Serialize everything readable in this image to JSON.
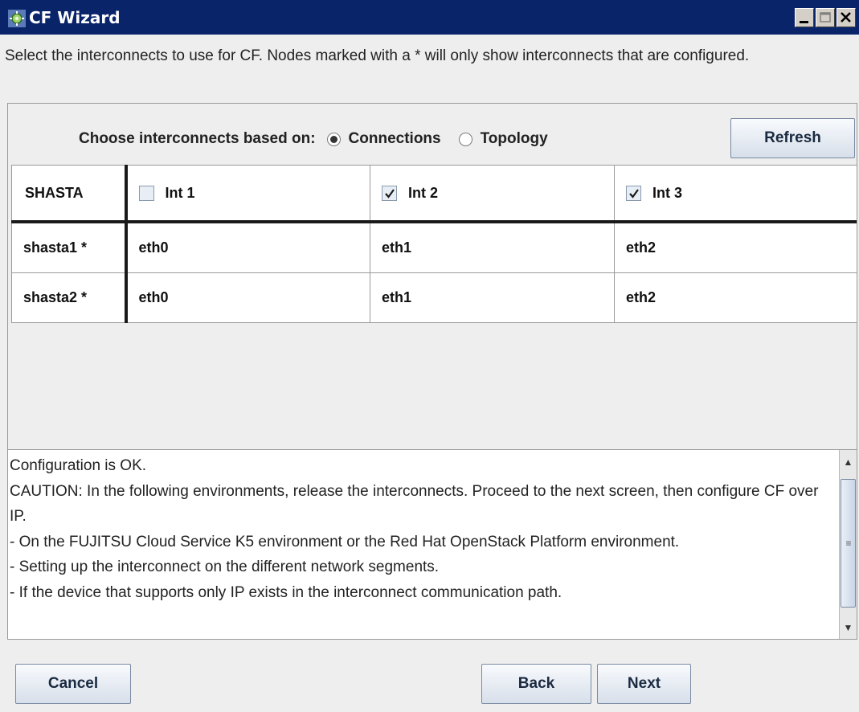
{
  "window": {
    "title": "CF Wizard",
    "title_bar_color": "#0a246a",
    "controls": [
      "minimize-icon",
      "maximize-icon",
      "close-icon"
    ]
  },
  "instructions": "Select the interconnects to use for CF.  Nodes marked with a * will only show interconnects that are configured.",
  "selector": {
    "label": "Choose interconnects based on:",
    "options": [
      {
        "label": "Connections",
        "selected": true
      },
      {
        "label": "Topology",
        "selected": false
      }
    ],
    "refresh_label": "Refresh"
  },
  "table": {
    "cluster_name": "SHASTA",
    "interconnects": [
      {
        "label": "Int 1",
        "checked": false
      },
      {
        "label": "Int 2",
        "checked": true
      },
      {
        "label": "Int 3",
        "checked": true
      }
    ],
    "rows": [
      {
        "node": "shasta1 *",
        "values": [
          "eth0",
          "eth1",
          "eth2"
        ]
      },
      {
        "node": "shasta2 *",
        "values": [
          "eth0",
          "eth1",
          "eth2"
        ]
      }
    ]
  },
  "messages": [
    "Configuration is OK.",
    "CAUTION: In the following environments, release the interconnects. Proceed to the next screen, then configure CF over IP.",
    "- On the FUJITSU Cloud Service K5 environment or the Red Hat OpenStack Platform environment.",
    "- Setting up the interconnect on the different network segments.",
    "- If the device that supports only IP exists in the interconnect communication path."
  ],
  "footer": {
    "cancel_label": "Cancel",
    "back_label": "Back",
    "next_label": "Next"
  }
}
